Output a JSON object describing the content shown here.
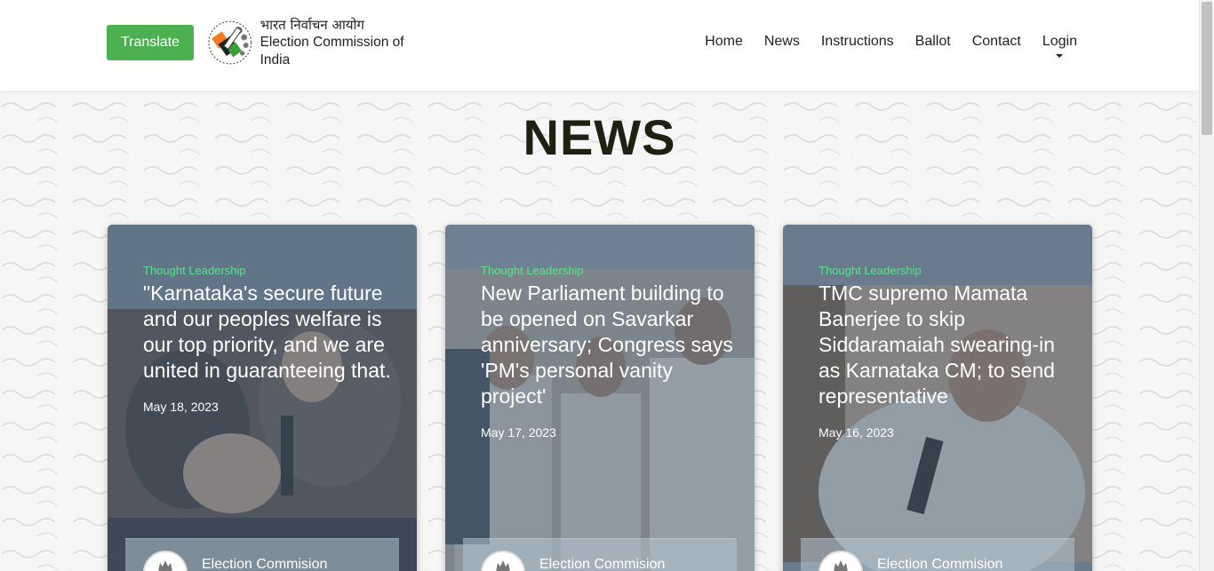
{
  "header": {
    "translate_label": "Translate",
    "logo": {
      "hindi": "भारत निर्वाचन आयोग",
      "english": "Election Commission of India"
    },
    "nav": [
      {
        "label": "Home"
      },
      {
        "label": "News"
      },
      {
        "label": "Instructions"
      },
      {
        "label": "Ballot"
      },
      {
        "label": "Contact"
      },
      {
        "label": "Login",
        "dropdown": true
      }
    ]
  },
  "page": {
    "title": "NEWS"
  },
  "cards": [
    {
      "category": "Thought Leadership",
      "title": "\"Karnataka's secure future and our peoples welfare is our top priority, and we are united in guaranteeing that.",
      "date": "May 18, 2023",
      "author": "Election Commision"
    },
    {
      "category": "Thought Leadership",
      "title": "New Parliament building to be opened on Savarkar anniversary; Congress says 'PM's personal vanity project'",
      "date": "May 17, 2023",
      "author": "Election Commision"
    },
    {
      "category": "Thought Leadership",
      "title": "TMC supremo Mamata Banerjee to skip Siddaramaiah swearing-in as Karnataka CM; to send representative",
      "date": "May 16, 2023",
      "author": "Election Commision"
    }
  ],
  "colors": {
    "translate_button": "#4caf50",
    "category_text": "#5de08a",
    "card_overlay": "#4a6076",
    "title_text": "#1f1f12"
  }
}
